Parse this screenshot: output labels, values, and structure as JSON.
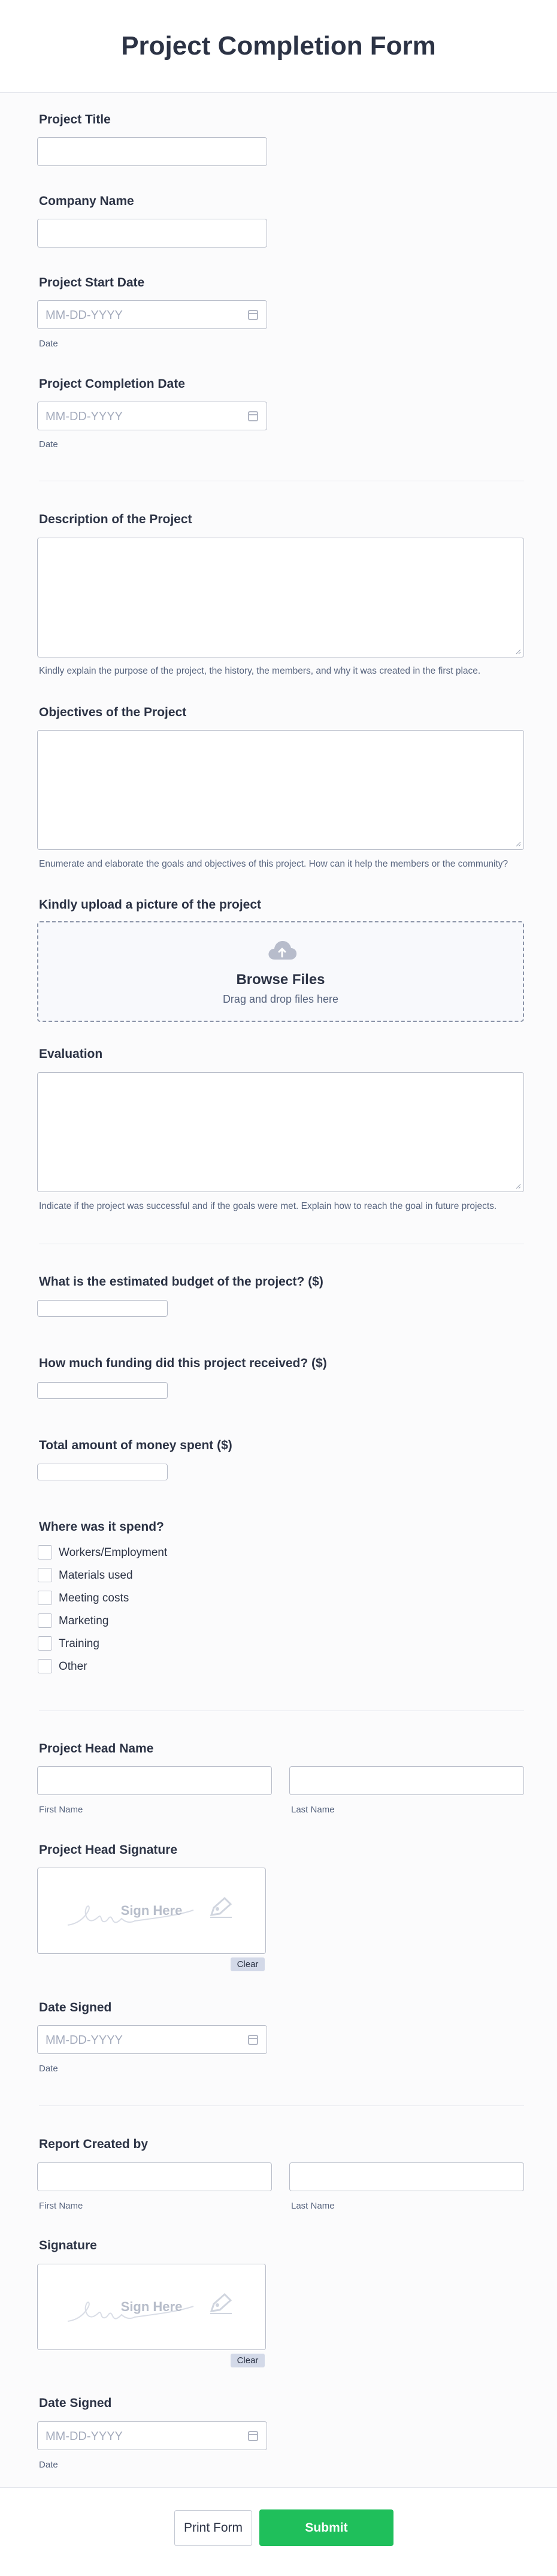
{
  "header": {
    "title": "Project Completion Form"
  },
  "fields": {
    "project_title": {
      "label": "Project Title"
    },
    "company_name": {
      "label": "Company Name"
    },
    "start_date": {
      "label": "Project Start Date",
      "placeholder": "MM-DD-YYYY",
      "sublabel": "Date"
    },
    "completion_date": {
      "label": "Project Completion Date",
      "placeholder": "MM-DD-YYYY",
      "sublabel": "Date"
    },
    "description": {
      "label": "Description of the Project",
      "hint": "Kindly explain the purpose of the project, the history, the members, and why it was created in the first place."
    },
    "objectives": {
      "label": "Objectives of the Project",
      "hint": "Enumerate and elaborate the goals and objectives of this project. How can it help the members or the community?"
    },
    "upload": {
      "label": "Kindly upload a picture of the project",
      "browse": "Browse Files",
      "drag": "Drag and drop files here"
    },
    "evaluation": {
      "label": "Evaluation",
      "hint": "Indicate if the project was successful and if the goals were met. Explain how to reach the goal in future projects."
    },
    "budget": {
      "label": "What is the estimated budget of the project? ($)"
    },
    "funding": {
      "label": "How much funding did this project received? ($)"
    },
    "spent": {
      "label": "Total amount of money spent ($)"
    },
    "where_spent": {
      "label": "Where was it spend?",
      "options": [
        "Workers/Employment",
        "Materials used",
        "Meeting costs",
        "Marketing",
        "Training",
        "Other"
      ]
    },
    "head_name": {
      "label": "Project Head Name",
      "first": "First Name",
      "last": "Last Name"
    },
    "head_signature": {
      "label": "Project Head Signature",
      "sign_here": "Sign Here",
      "clear": "Clear"
    },
    "date_signed_1": {
      "label": "Date Signed",
      "placeholder": "MM-DD-YYYY",
      "sublabel": "Date"
    },
    "report_by": {
      "label": "Report Created by",
      "first": "First Name",
      "last": "Last Name"
    },
    "signature": {
      "label": "Signature",
      "sign_here": "Sign Here",
      "clear": "Clear"
    },
    "date_signed_2": {
      "label": "Date Signed",
      "placeholder": "MM-DD-YYYY",
      "sublabel": "Date"
    }
  },
  "footer": {
    "print": "Print Form",
    "submit": "Submit"
  },
  "colors": {
    "submit": "#1fbf5b",
    "text": "#2c3345",
    "border": "#b8bdc9"
  },
  "icons": [
    "calendar-icon",
    "cloud-upload-icon",
    "pen-icon",
    "resize-grip-icon"
  ]
}
